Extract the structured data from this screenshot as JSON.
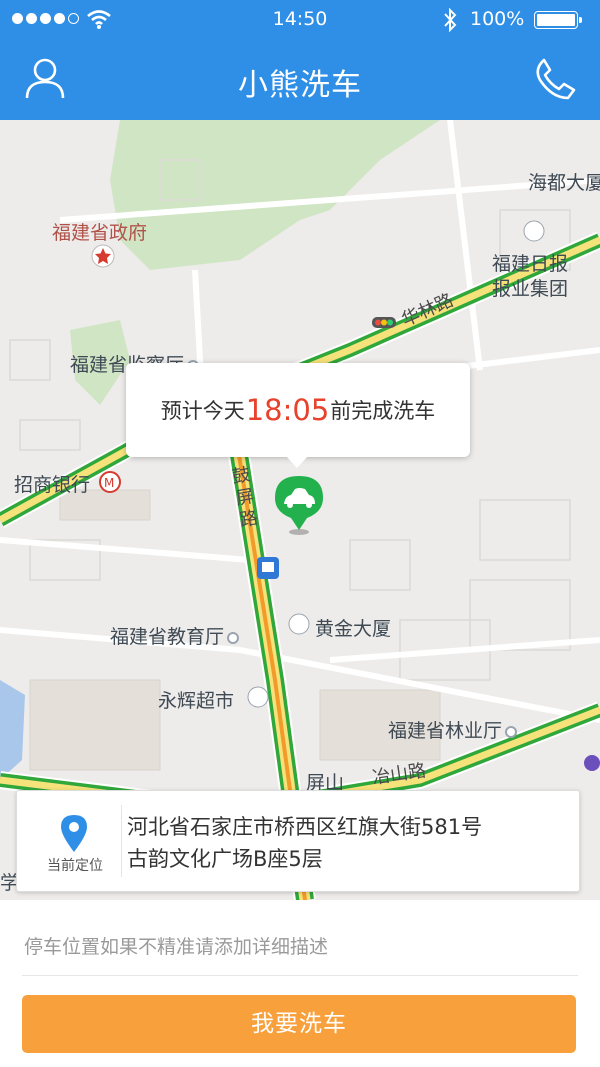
{
  "status_bar": {
    "time": "14:50",
    "battery": "100%"
  },
  "header": {
    "title": "小熊洗车",
    "user_icon": "user-icon",
    "phone_icon": "phone-icon"
  },
  "map": {
    "pois": {
      "haidu": "海都大厦",
      "province_gov": "福建省政府",
      "ribao_1": "福建日报",
      "ribao_2": "报业集团",
      "jiancha": "福建省监察厅",
      "zhaoshang": "招商银行",
      "jiaoyu": "福建省教育厅",
      "huangjin": "黄金大厦",
      "yonghui": "永辉超市",
      "linye": "福建省林业厅",
      "xue": "学",
      "pingshan": "屏山"
    },
    "roads": {
      "hualin": "华林路",
      "gupin": "鼓屏路",
      "yeshan": "冶山路"
    },
    "bubble": {
      "prefix": "预计今天",
      "time": "18:05",
      "suffix": "前完成洗车"
    },
    "car_icon": "car-pin-icon"
  },
  "location": {
    "label": "当前定位",
    "address_line1": "河北省石家庄市桥西区红旗大街581号",
    "address_line2": "古韵文化广场B座5层"
  },
  "form": {
    "description_placeholder": "停车位置如果不精准请添加详细描述",
    "wash_button": "我要洗车"
  },
  "colors": {
    "header_blue": "#2f8fe6",
    "button_orange": "#f8a03b",
    "time_red": "#e8412c",
    "pin_green": "#22b14c"
  }
}
